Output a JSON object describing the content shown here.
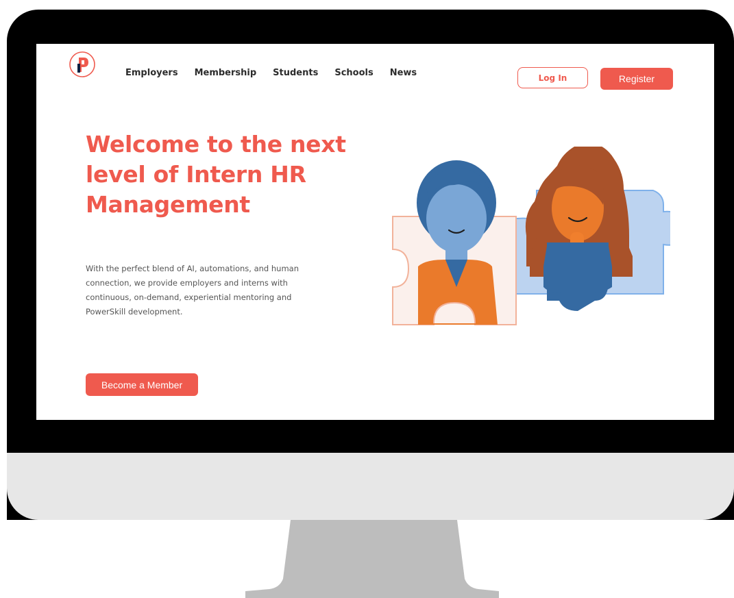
{
  "nav": {
    "links": [
      "Employers",
      "Membership",
      "Students",
      "Schools",
      "News"
    ],
    "login_label": "Log In",
    "register_label": "Register"
  },
  "hero": {
    "title": "Welcome to the next level of Intern HR Management",
    "description": "With the perfect blend of AI, automations, and human connection, we provide employers and interns with continuous, on-demand, experiential mentoring and PowerSkill development.",
    "cta_label": "Become a Member"
  },
  "icons": {
    "logo": "brand-logo-icon",
    "illustration": "two-people-puzzle-illustration"
  },
  "colors": {
    "accent": "#ef5a4e",
    "bezel": "#000000",
    "chin": "#e7e7e7",
    "stand": "#bdbdbd",
    "nav_text": "#2c2c2c",
    "body_text": "#555555"
  }
}
